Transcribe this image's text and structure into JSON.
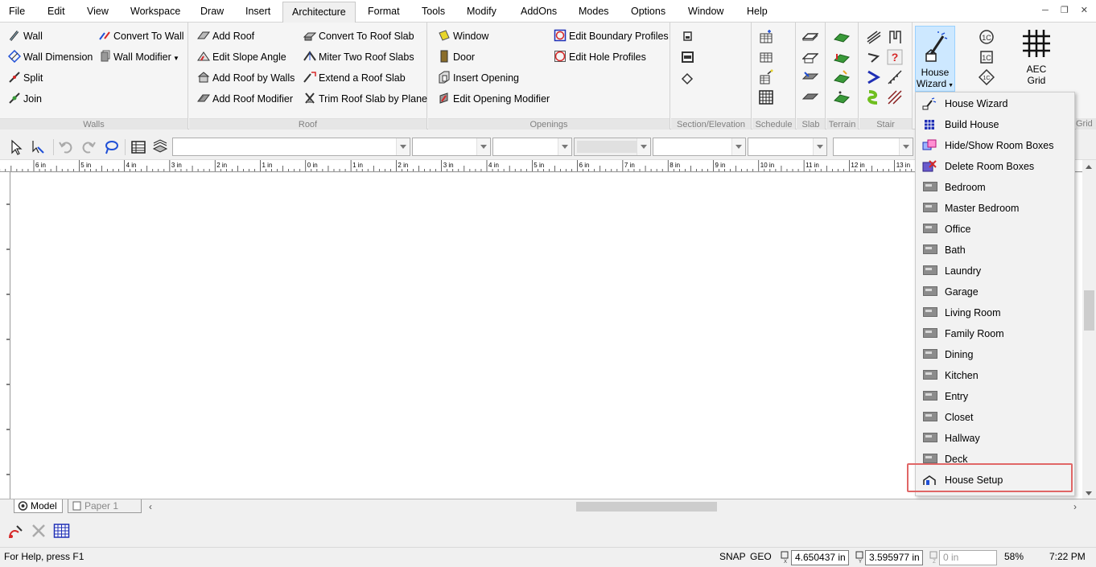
{
  "menubar": {
    "items": [
      "File",
      "Edit",
      "View",
      "Workspace",
      "Draw",
      "Insert",
      "Architecture",
      "Format",
      "Tools",
      "Modify",
      "AddOns",
      "Modes",
      "Options",
      "Window",
      "Help"
    ],
    "active": "Architecture"
  },
  "ribbon": {
    "walls": {
      "label": "Walls",
      "buttons": [
        "Wall",
        "Convert To Wall",
        "Wall Dimension",
        "Wall Modifier",
        "Split",
        "Join"
      ]
    },
    "roof": {
      "label": "Roof",
      "buttons": [
        "Add Roof",
        "Edit Slope Angle",
        "Add Roof by Walls",
        "Add Roof Modifier",
        "Convert To Roof Slab",
        "Miter Two Roof Slabs",
        "Extend a Roof Slab",
        "Trim Roof Slab by Plane"
      ]
    },
    "openings": {
      "label": "Openings",
      "buttons": [
        "Window",
        "Door",
        "Insert Opening",
        "Edit Opening Modifier",
        "Edit Boundary Profiles",
        "Edit Hole Profiles"
      ]
    },
    "section": {
      "label": "Section/Elevation"
    },
    "schedule": {
      "label": "Schedule"
    },
    "slab": {
      "label": "Slab"
    },
    "terrain": {
      "label": "Terrain"
    },
    "stair": {
      "label": "Stair"
    },
    "house_wizard": {
      "line1": "House",
      "line2": "Wizard"
    },
    "aec_grid": {
      "line1": "AEC",
      "line2": "Grid",
      "group_label": "Grid"
    }
  },
  "ruler": {
    "top_labels": [
      "6 in",
      "5 in",
      "4 in",
      "3 in",
      "2 in",
      "1 in",
      "0 in",
      "1 in",
      "2 in",
      "3 in",
      "4 in",
      "5 in",
      "6 in",
      "7 in",
      "8 in",
      "9 in",
      "10 in",
      "11 in",
      "12 in",
      "13 in"
    ]
  },
  "tabs": {
    "model": "Model",
    "paper": "Paper 1"
  },
  "dropdown": {
    "items": [
      "House Wizard",
      "Build House",
      "Hide/Show Room Boxes",
      "Delete Room Boxes",
      "Bedroom",
      "Master Bedroom",
      "Office",
      "Bath",
      "Laundry",
      "Garage",
      "Living Room",
      "Family Room",
      "Dining",
      "Kitchen",
      "Entry",
      "Closet",
      "Hallway",
      "Deck",
      "House Setup"
    ],
    "highlighted": "House Setup"
  },
  "statusbar": {
    "help": "For Help, press F1",
    "snap": "SNAP",
    "geo": "GEO",
    "x_label": "X",
    "y_label": "Y",
    "z_label": "Z",
    "x": "4.650437 in",
    "y": "3.595977 in",
    "z": "0 in",
    "zoom": "58%",
    "time": "7:22 PM"
  },
  "colors": {
    "accent_highlight": "#e06666",
    "selected_button_bg": "#cde8ff"
  }
}
